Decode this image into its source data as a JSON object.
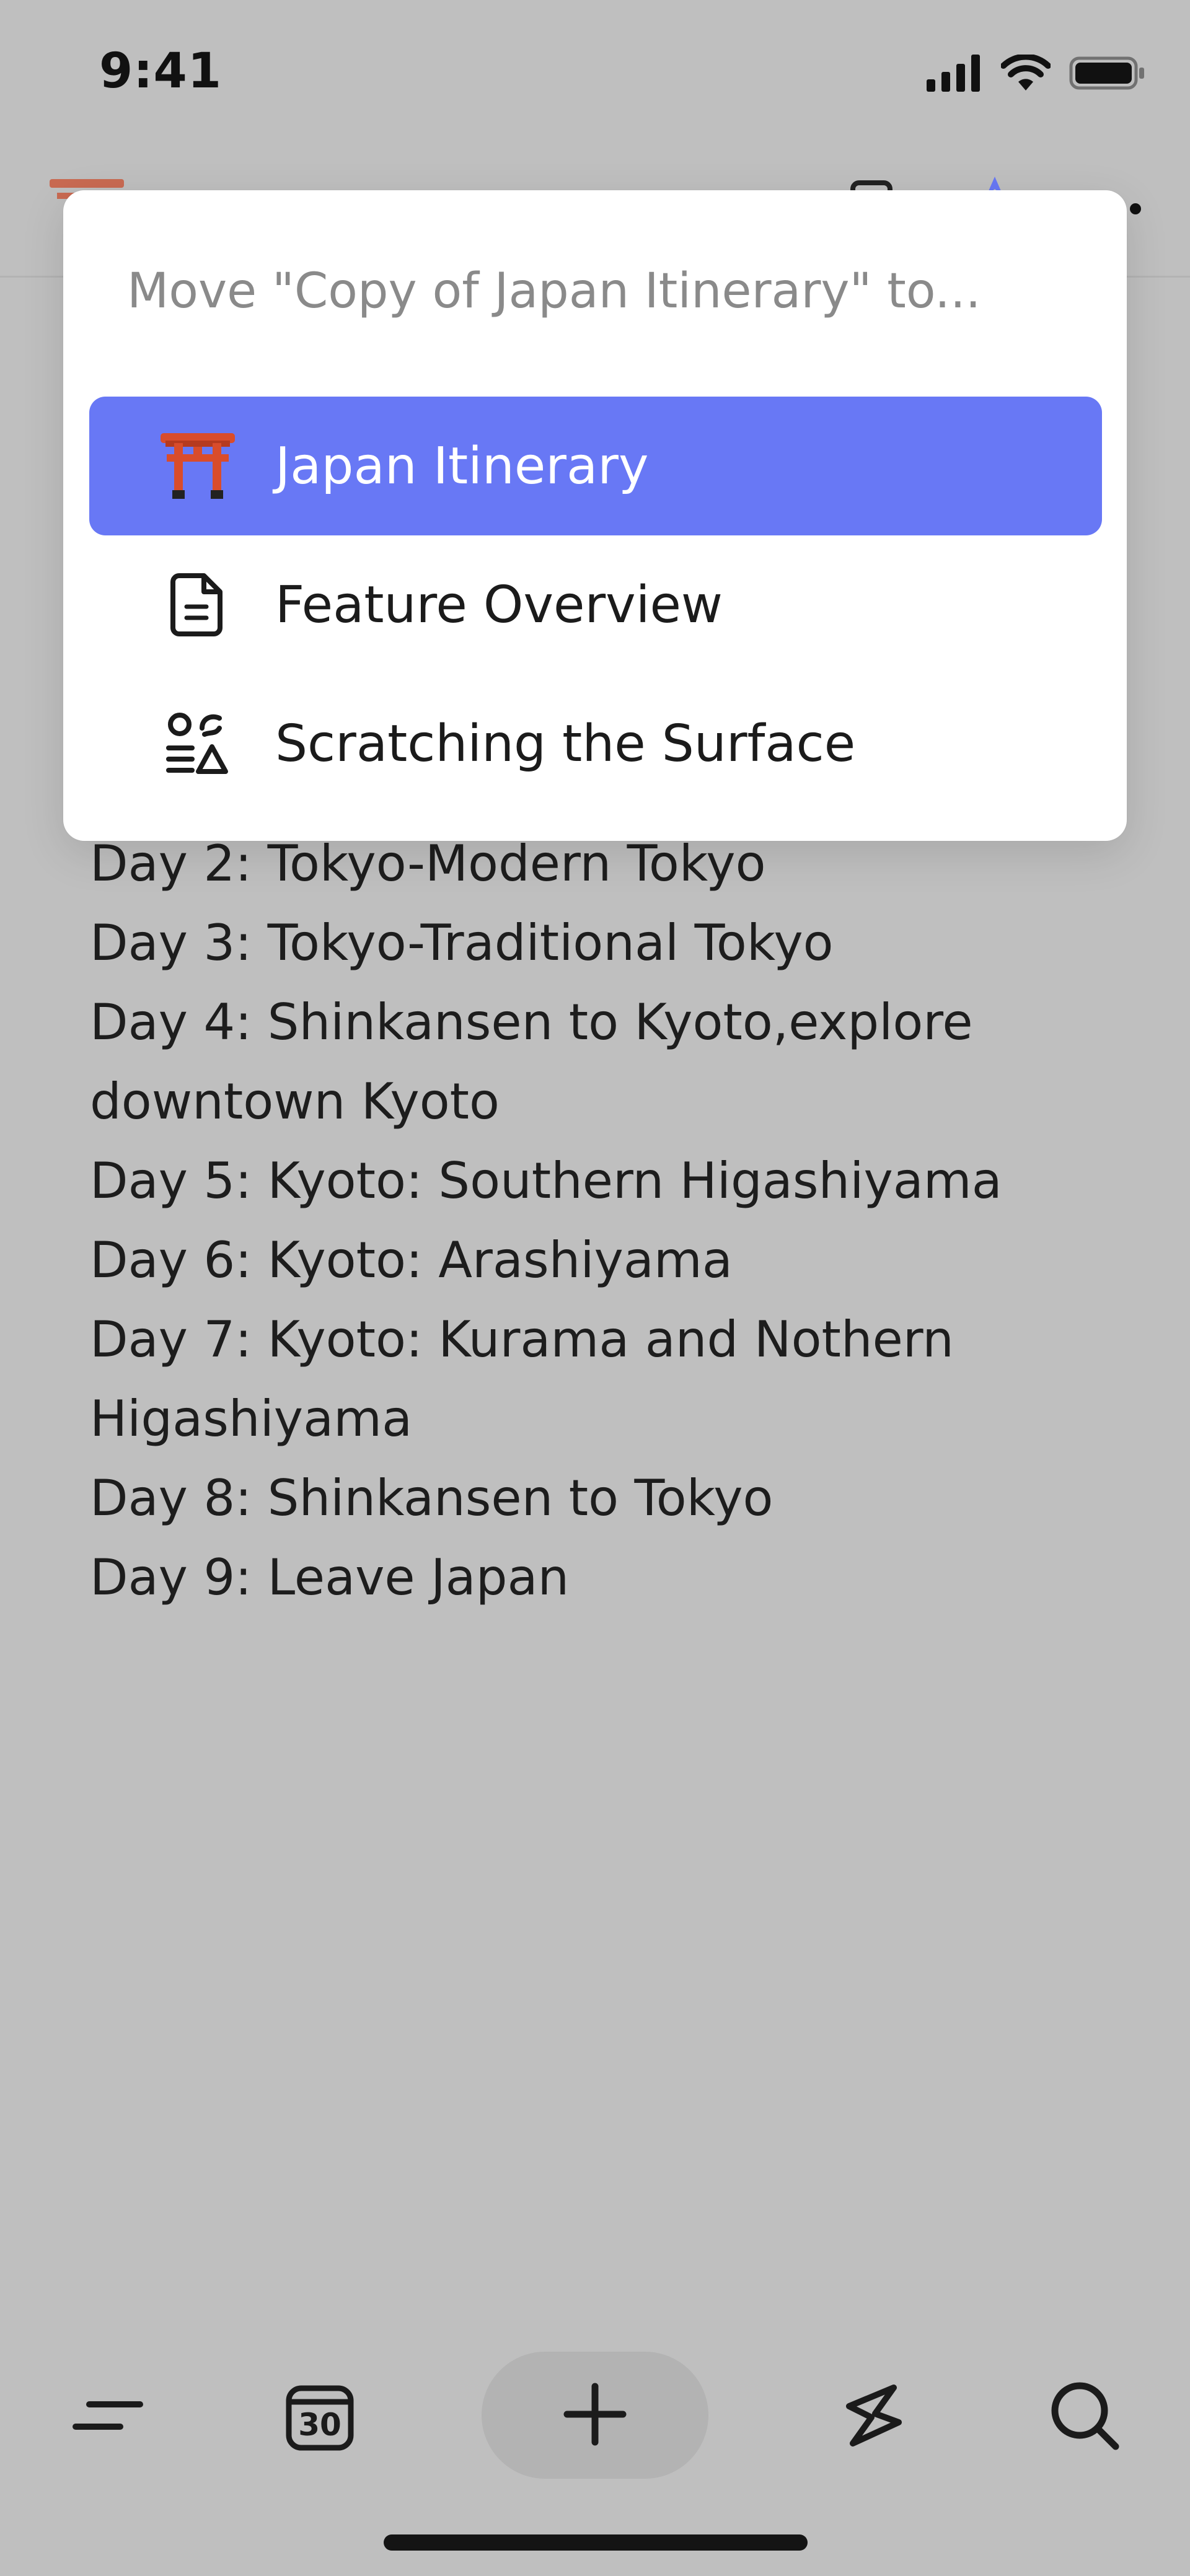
{
  "status_bar": {
    "time": "9:41"
  },
  "document": {
    "lines": [
      "Day 2: Tokyo-Modern Tokyo",
      "Day 3: Tokyo-Traditional Tokyo",
      "Day 4: Shinkansen to Kyoto,explore",
      "downtown Kyoto",
      "Day 5: Kyoto: Southern Higashiyama",
      "Day 6: Kyoto: Arashiyama",
      "Day 7: Kyoto: Kurama and Nothern",
      "Higashiyama",
      "Day 8: Shinkansen to Tokyo",
      "Day 9: Leave Japan"
    ]
  },
  "move_dialog": {
    "title": "Move \"Copy of Japan Itinerary\" to...",
    "items": [
      {
        "label": "Japan Itinerary",
        "icon": "torii-gate-icon",
        "selected": true
      },
      {
        "label": "Feature Overview",
        "icon": "document-icon",
        "selected": false
      },
      {
        "label": "Scratching the Surface",
        "icon": "shapes-icon",
        "selected": false
      }
    ]
  },
  "toolbar": {
    "items": [
      {
        "icon": "menu-icon"
      },
      {
        "icon": "calendar-icon",
        "label": "30"
      },
      {
        "icon": "plus-icon"
      },
      {
        "icon": "shortcuts-icon"
      },
      {
        "icon": "search-icon"
      }
    ]
  },
  "colors": {
    "background_dim": "#bfbfbf",
    "accent": "#6878f5",
    "torii_red": "#d94c2b",
    "dialog_bg": "#ffffff",
    "muted_text": "#8a8a8a"
  }
}
